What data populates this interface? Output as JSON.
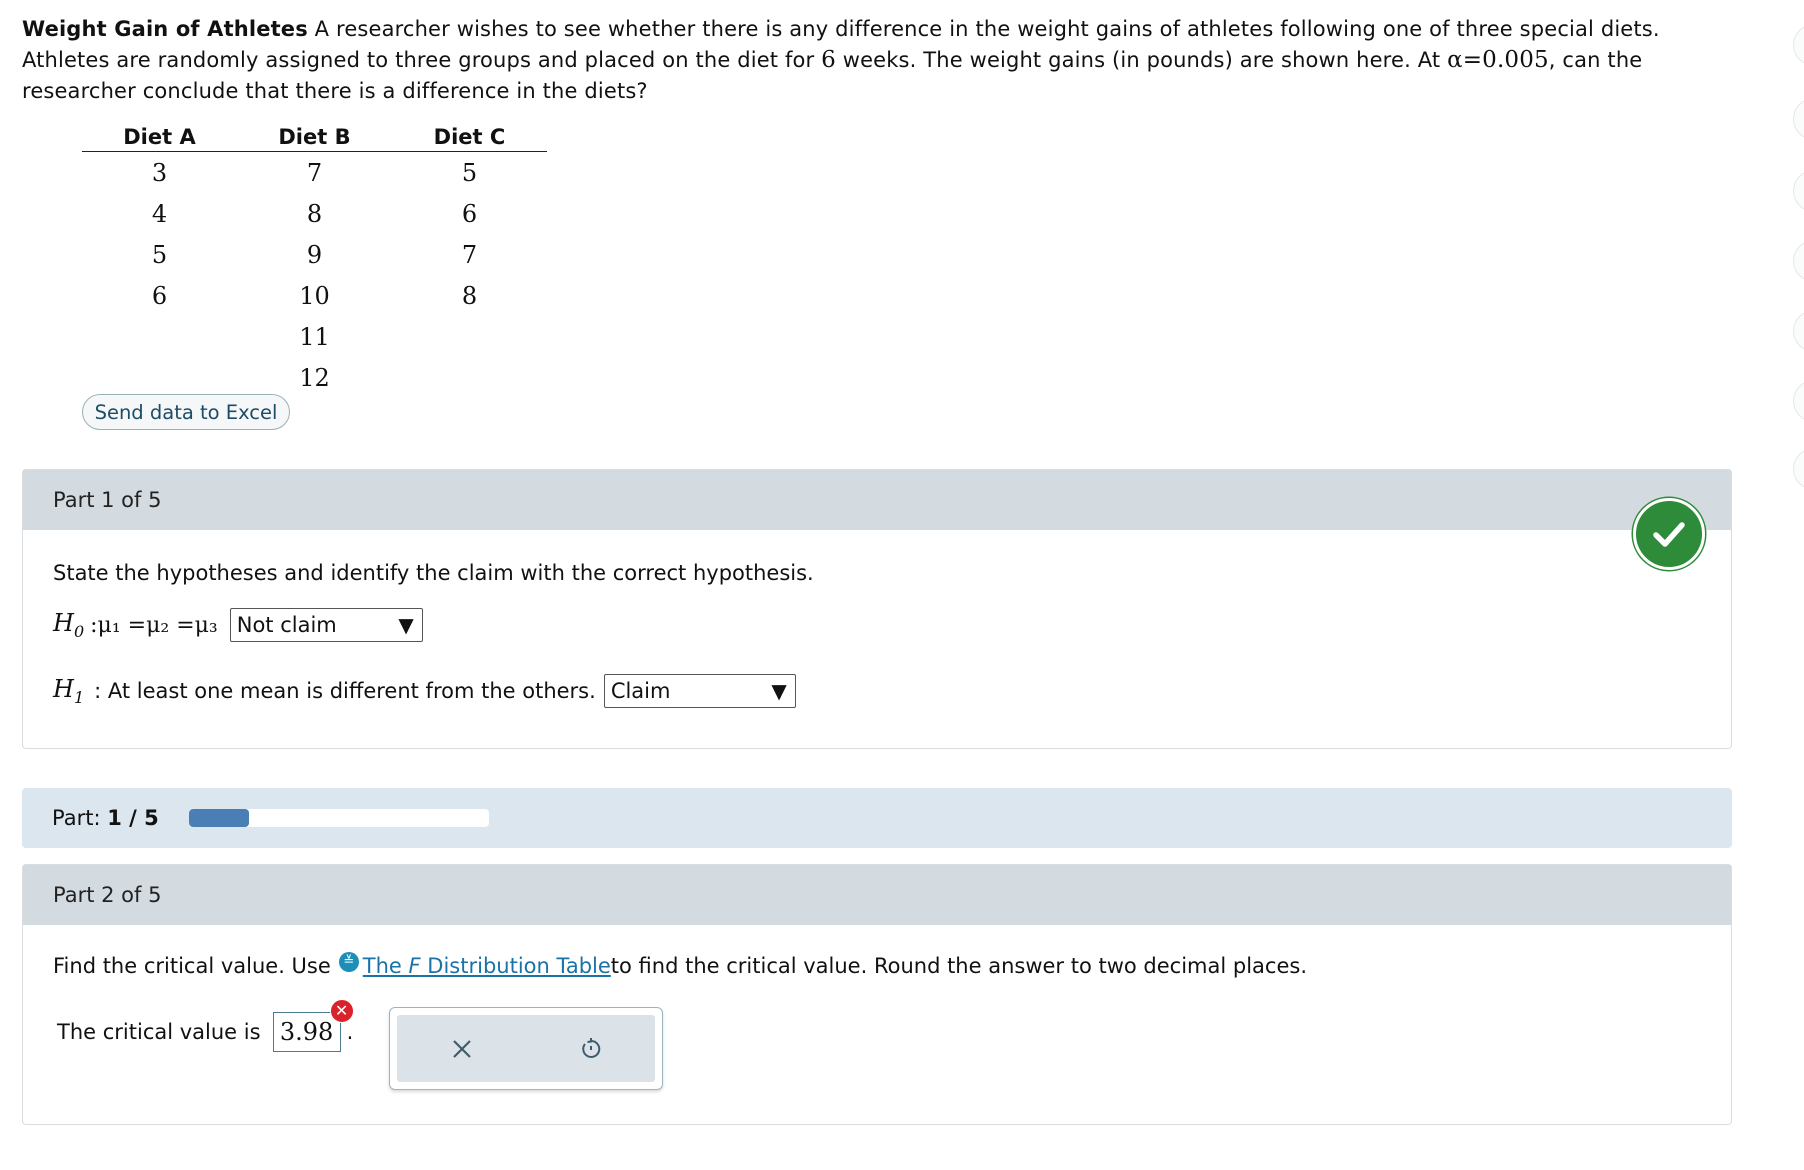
{
  "problem": {
    "title": "Weight Gain of Athletes",
    "text_1": " A researcher wishes to see whether there is any difference in the weight gains of athletes following one of three special diets. Athletes are randomly assigned to three groups and placed on the diet for ",
    "weeks": "6",
    "text_2": " weeks. The weight gains (in pounds) are shown here. At ",
    "alpha": "α=0.005",
    "text_3": ", can the researcher conclude that there is a difference in the diets?"
  },
  "data_table": {
    "headers": [
      "Diet A",
      "Diet B",
      "Diet C"
    ],
    "rows": [
      [
        "3",
        "7",
        "5"
      ],
      [
        "4",
        "8",
        "6"
      ],
      [
        "5",
        "9",
        "7"
      ],
      [
        "6",
        "10",
        "8"
      ],
      [
        "",
        "11",
        ""
      ],
      [
        "",
        "12",
        ""
      ]
    ],
    "excel_button": "Send data to Excel"
  },
  "part1": {
    "header": "Part 1 of 5",
    "instruction": "State the hypotheses and identify the claim with the correct hypothesis.",
    "h0_symbol": "H",
    "h0_sub": "0",
    "h0_expr": ":μ₁ =μ₂ =μ₃",
    "h0_select": "Not claim",
    "h1_symbol": "H",
    "h1_sub": "1",
    "h1_text": ": At least one mean is different from the others.",
    "h1_select": "Claim",
    "status_icon": "check-icon",
    "status_color": "#2e8b3a"
  },
  "progress": {
    "label": "Part: ",
    "value": "1 / 5",
    "fraction": 0.2,
    "color": "#4a7fb5"
  },
  "part2": {
    "header": "Part 2 of 5",
    "instruction_1": "Find the critical value. Use ",
    "link_text_pre": "The ",
    "link_text_f": "F",
    "link_text_post": " Distribution Table",
    "instruction_2": " to find the critical value. Round the answer to two decimal places.",
    "critical_label": "The critical value is",
    "critical_value": "3.98",
    "period": ".",
    "error_color": "#d8232a"
  }
}
